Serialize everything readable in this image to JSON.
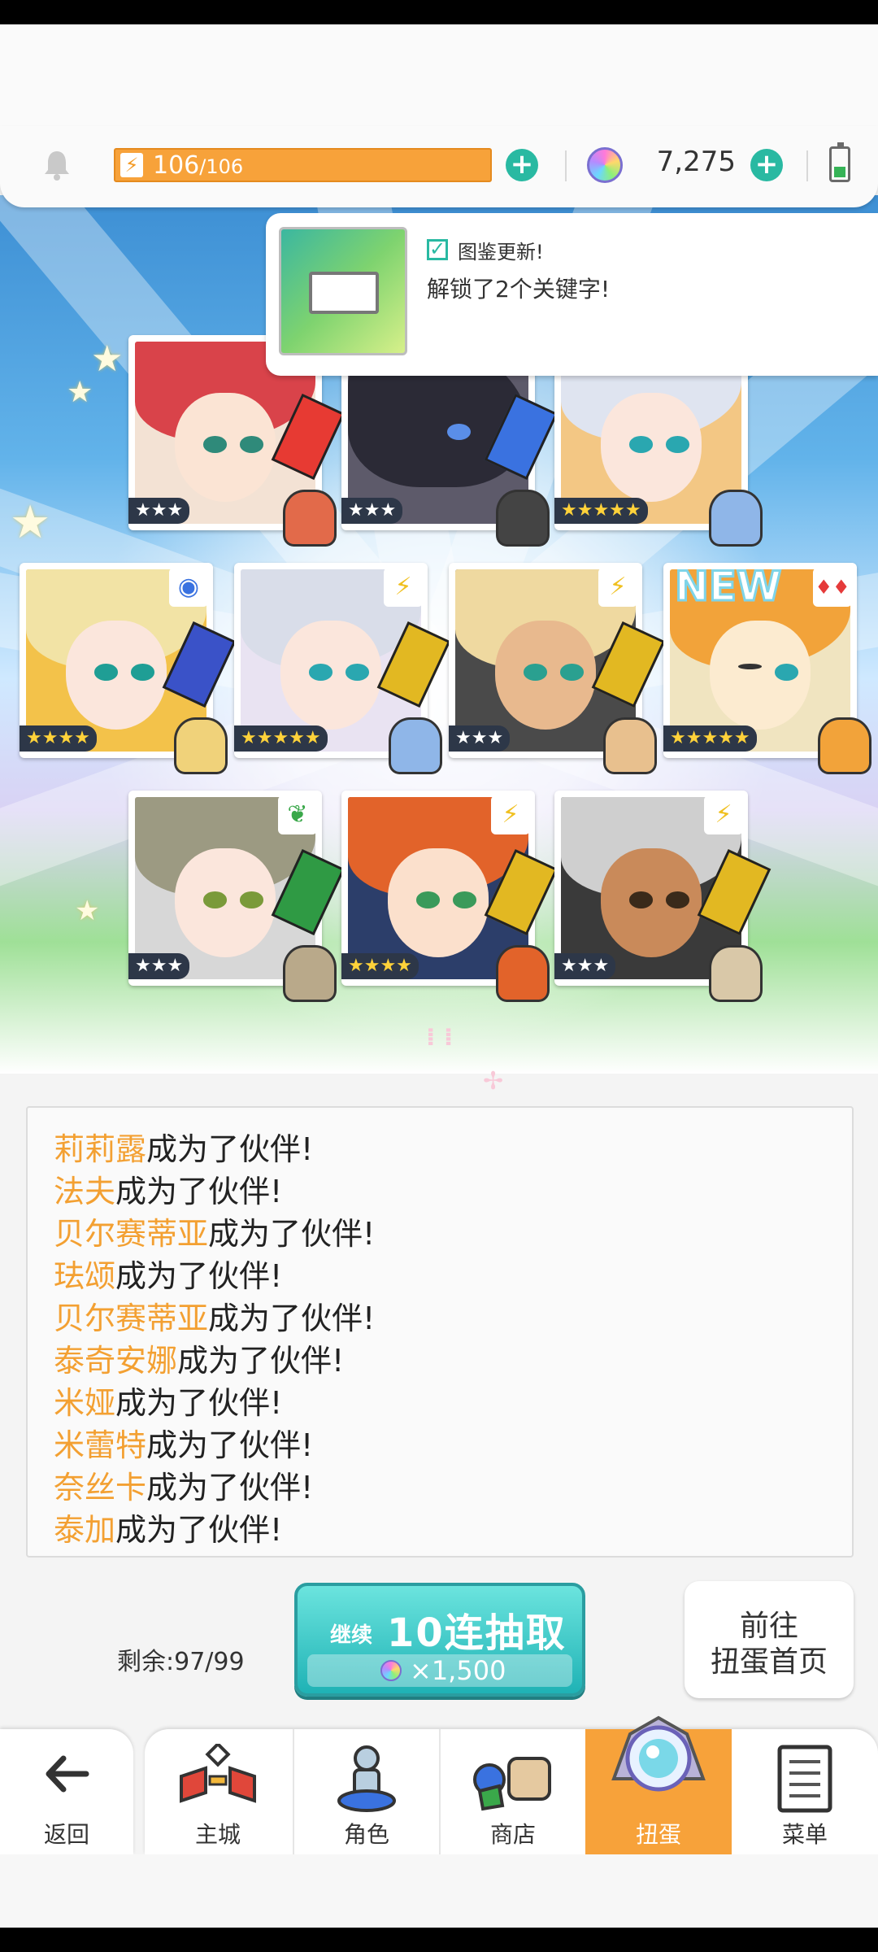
{
  "topbar": {
    "energy_current": "106",
    "energy_max": "/106",
    "energy_bolt": "⚡",
    "gems": "7,275",
    "plus_label": "+",
    "icons": [
      "bell-icon",
      "lightning-icon",
      "plus-icon",
      "rainbow-gem-icon",
      "battery-icon"
    ]
  },
  "notification": {
    "title": "图鉴更新!",
    "message": "解锁了2个关键字!",
    "check": "✓"
  },
  "cards": [
    {
      "stars": "★★★",
      "rarity": 3,
      "badge": "♦",
      "element": "fire"
    },
    {
      "stars": "★★★",
      "rarity": 3,
      "badge": "",
      "element": "water"
    },
    {
      "stars": "★★★★★",
      "rarity": 5,
      "badge": "",
      "element": "wind"
    },
    {
      "stars": "★★★★",
      "rarity": 4,
      "badge": "◉",
      "element": "water"
    },
    {
      "stars": "★★★★★",
      "rarity": 5,
      "badge": "⚡",
      "element": "light"
    },
    {
      "stars": "★★★",
      "rarity": 3,
      "badge": "⚡",
      "element": "light"
    },
    {
      "stars": "★★★★★",
      "rarity": 5,
      "badge": "♦♦",
      "element": "fire",
      "new_tag": "NEW"
    },
    {
      "stars": "★★★",
      "rarity": 3,
      "badge": "❦",
      "element": "earth"
    },
    {
      "stars": "★★★★",
      "rarity": 4,
      "badge": "⚡",
      "element": "light"
    },
    {
      "stars": "★★★",
      "rarity": 3,
      "badge": "⚡",
      "element": "light"
    }
  ],
  "log": {
    "suffix": "成为了伙伴!",
    "entries": [
      {
        "name": "莉莉露"
      },
      {
        "name": "法夫"
      },
      {
        "name": "贝尔赛蒂亚"
      },
      {
        "name": "珐颂"
      },
      {
        "name": "贝尔赛蒂亚"
      },
      {
        "name": "泰奇安娜"
      },
      {
        "name": "米娅"
      },
      {
        "name": "米蕾特"
      },
      {
        "name": "奈丝卡"
      },
      {
        "name": "泰加"
      }
    ]
  },
  "gacha": {
    "remaining": "剩余:97/99",
    "continue_label": "继续",
    "pull_label": "10连抽取",
    "cost": "×1,500",
    "home_line1": "前往",
    "home_line2": "扭蛋首页"
  },
  "nav": {
    "back": "返回",
    "items": [
      {
        "label": "主城",
        "icon": "castle-icon"
      },
      {
        "label": "角色",
        "icon": "character-icon"
      },
      {
        "label": "商店",
        "icon": "shop-icon"
      },
      {
        "label": "扭蛋",
        "icon": "gacha-icon",
        "active": true
      },
      {
        "label": "菜单",
        "icon": "menu-icon"
      }
    ]
  },
  "colors": {
    "accent_orange": "#f7a23a",
    "teal": "#29b9a2",
    "name_orange": "#f3a032"
  }
}
